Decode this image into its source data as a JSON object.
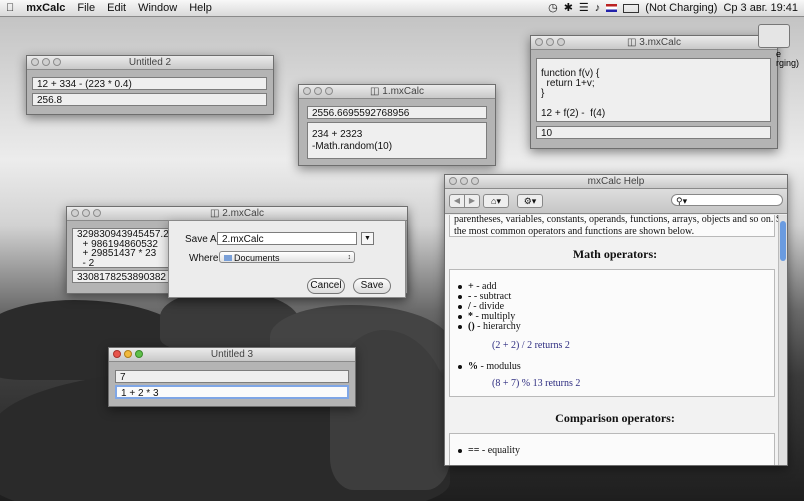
{
  "menubar": {
    "app_name": "mxCalc",
    "items": [
      "File",
      "Edit",
      "Window",
      "Help"
    ],
    "battery_status": "(Not Charging)",
    "clock": "Ср 3 авг.  19:41"
  },
  "desktop": {
    "icon_label": "e\nrging)"
  },
  "windows": {
    "untitled2": {
      "title": "Untitled 2",
      "expression": "12 + 334 - (223 * 0.4)",
      "result": "256.8"
    },
    "mxcalc1": {
      "title": "1.mxCalc",
      "result": "2556.6695592768956",
      "expression": "234 + 2323\n-Math.random(10)"
    },
    "mxcalc3": {
      "title": "3.mxCalc",
      "code": "function f(v) {\n  return 1+v;\n}\n\n12 + f(2) -  f(4)",
      "result": "10"
    },
    "mxcalc2": {
      "title": "2.mxCalc",
      "expression": "329830943945457.2\n  + 986194860532\n  + 29851437 * 23\n  - 2",
      "result": "3308178253890382"
    },
    "untitled3": {
      "title": "Untitled 3",
      "result": "7",
      "expression": "1 + 2 * 3"
    }
  },
  "save_sheet": {
    "save_as_label": "Save As:",
    "filename": "2.mxCalc",
    "where_label": "Where:",
    "location": "Documents",
    "cancel_label": "Cancel",
    "save_label": "Save"
  },
  "help": {
    "title": "mxCalc Help",
    "search_placeholder": "",
    "intro_line1": "parentheses, variables, constants, operands, functions, arrays, objects and so on. Some of",
    "intro_line2": "the most common operators and functions are shown below.",
    "math_heading": "Math operators:",
    "math_ops": [
      {
        "sym": "+",
        "desc": " - add"
      },
      {
        "sym": "-",
        "desc": " - subtract"
      },
      {
        "sym": "/",
        "desc": " - divide"
      },
      {
        "sym": "*",
        "desc": " - multiply"
      },
      {
        "sym": "()",
        "desc": " - hierarchy"
      }
    ],
    "example1": "(2 + 2) / 2 returns 2",
    "mod_sym": "%",
    "mod_desc": " - modulus",
    "example2": "(8 + 7) % 13 returns 2",
    "comparison_heading": "Comparison operators:",
    "eq_sym": "==",
    "eq_desc": " - equality"
  }
}
